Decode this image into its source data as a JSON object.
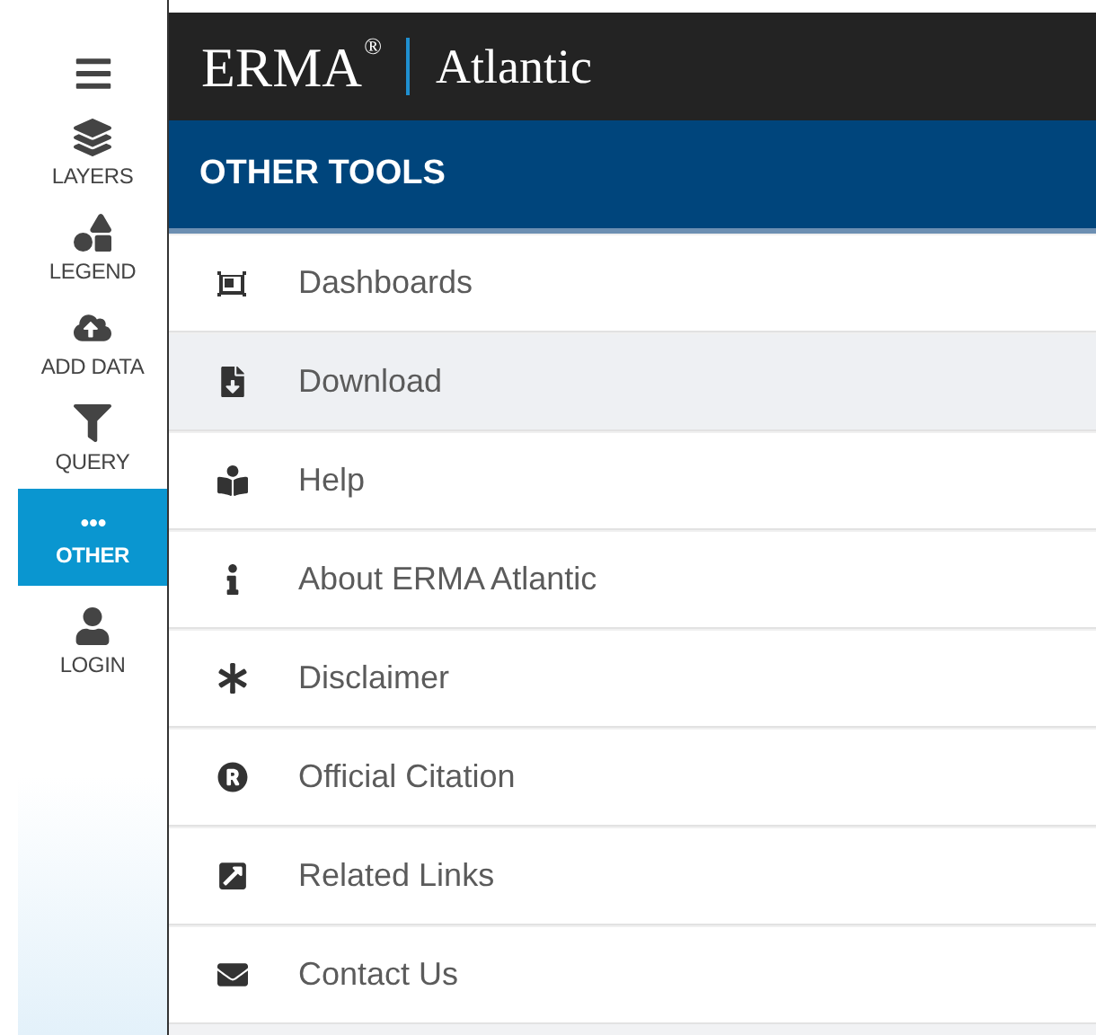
{
  "sidebar": {
    "items": [
      {
        "label": "LAYERS",
        "selected": false
      },
      {
        "label": "LEGEND",
        "selected": false
      },
      {
        "label": "ADD DATA",
        "selected": false
      },
      {
        "label": "QUERY",
        "selected": false
      },
      {
        "label": "OTHER",
        "selected": true
      },
      {
        "label": "LOGIN",
        "selected": false
      }
    ]
  },
  "header": {
    "logo": "ERMA$^{®}$",
    "region": "Atlantic"
  },
  "panel": {
    "title": "OTHER TOOLS",
    "items": [
      {
        "label": "Dashboards",
        "highlighted": false
      },
      {
        "label": "Download",
        "highlighted": true
      },
      {
        "label": "Help",
        "highlighted": false
      },
      {
        "label": "About ERMA Atlantic",
        "highlighted": false
      },
      {
        "label": "Disclaimer",
        "highlighted": false
      },
      {
        "label": "Official Citation",
        "highlighted": false
      },
      {
        "label": "Related Links",
        "highlighted": false
      },
      {
        "label": "Contact Us",
        "highlighted": false
      }
    ]
  }
}
